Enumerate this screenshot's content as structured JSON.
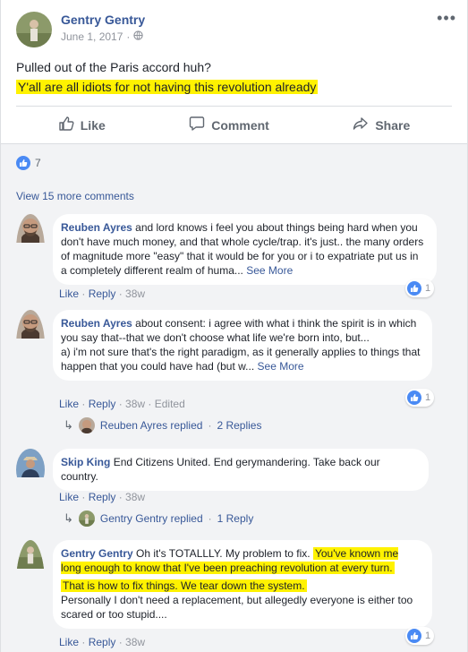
{
  "post": {
    "author": "Gentry Gentry",
    "date": "June 1, 2017",
    "privacy_icon": "globe-icon",
    "menu_icon": "more-dots-icon",
    "line1": "Pulled out of the Paris accord huh?",
    "line2": "Y'all are all idiots for not having this revolution already",
    "highlight_color": "#fff200"
  },
  "actions": {
    "like": "Like",
    "comment": "Comment",
    "share": "Share"
  },
  "reactions": {
    "count": "7",
    "color": "#4a8af4"
  },
  "view_more": "View 15 more comments",
  "comments": [
    {
      "name": "Reuben Ayres",
      "text": "and lord knows i feel you about things being hard when you don't have much money, and that whole cycle/trap. it's just.. the many orders of magnitude more \"easy\" that it would be for you or i to expatriate put us in a completely different realm of huma...",
      "see_more": "See More",
      "like": "Like",
      "reply": "Reply",
      "time": "38w",
      "reactions": "1"
    },
    {
      "name": "Reuben Ayres",
      "text_l1": "about consent: i agree with what i think the spirit is in which you say that--that we don't choose what life we're born into, but...",
      "text_l2": "a) i'm not sure that's the right paradigm, as it generally applies to things that happen that you could have had (but w...",
      "see_more": "See More",
      "like": "Like",
      "reply": "Reply",
      "time": "38w",
      "edited": "Edited",
      "reactions": "1",
      "replies_name": "Reuben Ayres replied",
      "replies_count": "2 Replies"
    },
    {
      "name": "Skip King",
      "text": "End Citizens United. End gerymandering. Take back our country.",
      "like": "Like",
      "reply": "Reply",
      "time": "38w",
      "replies_name": "Gentry Gentry replied",
      "replies_count": "1 Reply"
    },
    {
      "name": "Gentry Gentry",
      "text_a": "Oh it's TOTALLLY. My problem to fix.",
      "text_b": "You've known me long enough to know that I've been preaching revolution at every turn.",
      "text_c": "That is how to fix things. We tear down the system.",
      "text_d": "Personally I don't need a replacement, but allegedly everyone is either too scared or too stupid....",
      "like": "Like",
      "reply": "Reply",
      "time": "38w",
      "reactions": "1"
    }
  ]
}
